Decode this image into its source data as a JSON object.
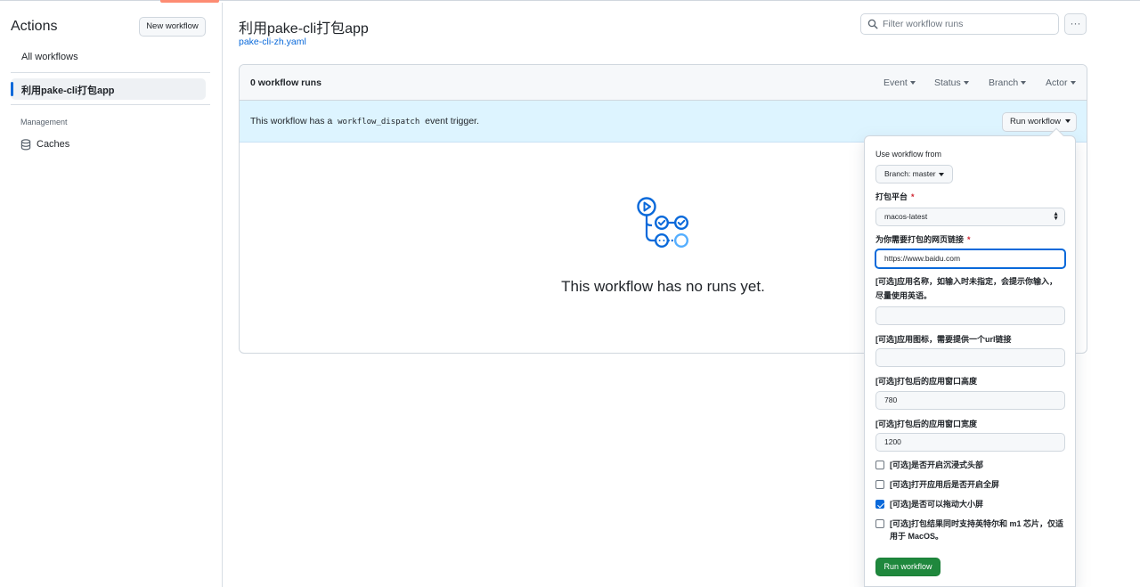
{
  "sidebar": {
    "title": "Actions",
    "new_workflow_label": "New workflow",
    "all_workflows_label": "All workflows",
    "active_workflow_label": "利用pake-cli打包app",
    "management_label": "Management",
    "caches_label": "Caches"
  },
  "header": {
    "title": "利用pake-cli打包app",
    "file": "pake-cli-zh.yaml",
    "filter_placeholder": "Filter workflow runs",
    "more_label": "···"
  },
  "runs": {
    "count_label": "0 workflow runs",
    "filters": [
      "Event",
      "Status",
      "Branch",
      "Actor"
    ],
    "dispatch_before": "This workflow has a",
    "dispatch_code": "workflow_dispatch",
    "dispatch_after": "event trigger.",
    "run_workflow_label": "Run workflow",
    "empty_message": "This workflow has no runs yet."
  },
  "panel": {
    "use_workflow_from": "Use workflow from",
    "branch_label": "Branch: master",
    "platform_label": "打包平台",
    "required_mark": "*",
    "platform_value": "macos-latest",
    "url_label": "为你需要打包的网页链接",
    "url_value": "https://www.baidu.com",
    "name_label_1": "[可选]应用名称，如输入时未指定，会提示你输入，",
    "name_label_2": "尽量使用英语。",
    "name_value": "",
    "icon_label": "[可选]应用图标，需要提供一个url链接",
    "icon_value": "",
    "height_label": "[可选]打包后的应用窗口高度",
    "height_value": "780",
    "width_label": "[可选]打包后的应用窗口宽度",
    "width_value": "1200",
    "checkboxes": [
      {
        "label": "[可选]是否开启沉浸式头部",
        "checked": false
      },
      {
        "label": "[可选]打开应用后是否开启全屏",
        "checked": false
      },
      {
        "label": "[可选]是否可以拖动大小屏",
        "checked": true
      },
      {
        "label": "[可选]打包结果同时支持英特尔和 m1 芯片，仅适用于 MacOS。",
        "checked": false
      }
    ],
    "run_button_label": "Run workflow"
  },
  "colors": {
    "accent": "#0969da",
    "primary_button": "#1f883d",
    "dispatch_bg": "#ddf4ff",
    "required": "#cf222e",
    "tab_underline": "#fd8c73"
  },
  "icons": {
    "caches": "database-icon",
    "filter": "search-icon",
    "empty_state": "workflow-graph-icon"
  }
}
